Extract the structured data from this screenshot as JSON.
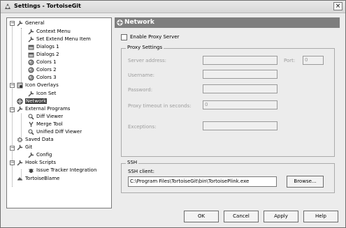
{
  "window": {
    "title": "Settings - TortoiseGit",
    "close_label": "×"
  },
  "tree": {
    "general": "General",
    "context_menu": "Context Menu",
    "set_extend_menu_item": "Set Extend Menu Item",
    "dialogs1": "Dialogs 1",
    "dialogs2": "Dialogs 2",
    "colors1": "Colors 1",
    "colors2": "Colors 2",
    "colors3": "Colors 3",
    "icon_overlays": "Icon Overlays",
    "icon_set": "Icon Set",
    "network": "Network",
    "external_programs": "External Programs",
    "diff_viewer": "Diff Viewer",
    "merge_tool": "Merge Tool",
    "unified_diff_viewer": "Unified Diff Viewer",
    "saved_data": "Saved Data",
    "git": "Git",
    "config": "Config",
    "hook_scripts": "Hook Scripts",
    "issue_tracker_integration": "Issue Tracker Integration",
    "tortoiseblame": "TortoiseBlame"
  },
  "panel": {
    "title": "Network",
    "enable_proxy": "Enable Proxy Server",
    "proxy_settings": "Proxy Settings",
    "server_address": "Server address:",
    "port": "Port:",
    "port_value": "0",
    "username": "Username:",
    "password": "Password:",
    "proxy_timeout": "Proxy timeout in seconds:",
    "timeout_value": "0",
    "exceptions": "Exceptions:",
    "ssh_group": "SSH",
    "ssh_client_label": "SSH client:",
    "ssh_client_value": "C:\\Program Files\\TortoiseGit\\bin\\TortoisePlink.exe",
    "browse": "Browse..."
  },
  "buttons": {
    "ok": "OK",
    "cancel": "Cancel",
    "apply": "Apply",
    "help": "Help"
  },
  "colors": {
    "panel_header": "#7e7e7e",
    "selection": "#3b3b3b"
  }
}
